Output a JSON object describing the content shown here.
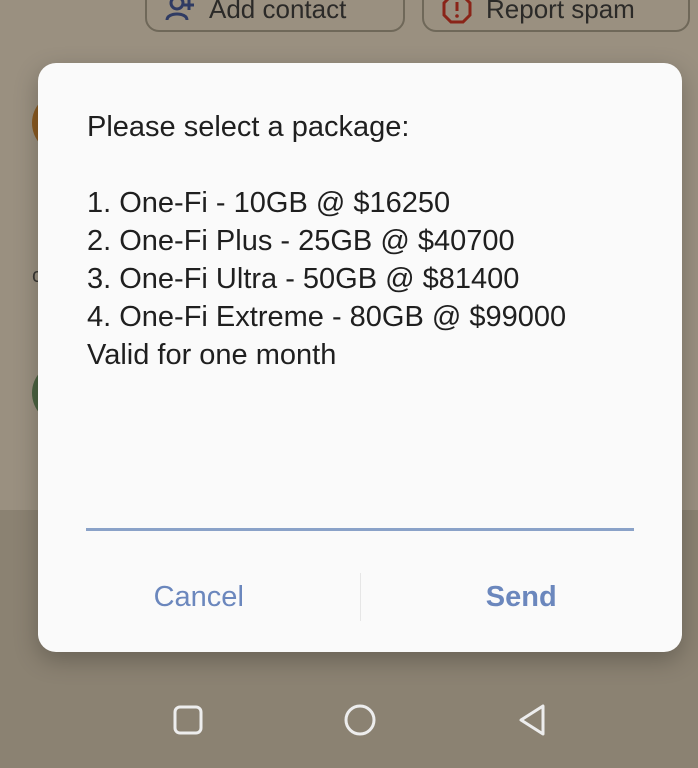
{
  "background": {
    "chips": {
      "add_contact": "Add contact",
      "report_spam": "Report spam"
    },
    "icons": {
      "add_contact": "person-add-icon",
      "report_spam": "report-octagon-icon"
    }
  },
  "dialog": {
    "message": "Please select a package:\n\n1. One-Fi - 10GB @ $16250\n2. One-Fi Plus - 25GB @ $40700\n3. One-Fi Ultra - 50GB @ $81400\n4. One-Fi Extreme - 80GB @ $99000\nValid for one month",
    "input_value": "",
    "cancel_label": "Cancel",
    "send_label": "Send"
  },
  "navbar": {
    "icons": [
      "recents-square-icon",
      "home-circle-icon",
      "back-triangle-icon"
    ]
  },
  "colors": {
    "accent": "#6b87bd",
    "input_underline": "#8aa2c8",
    "dialog_bg": "#fafafa",
    "scrim_bg": "#9a9080"
  }
}
